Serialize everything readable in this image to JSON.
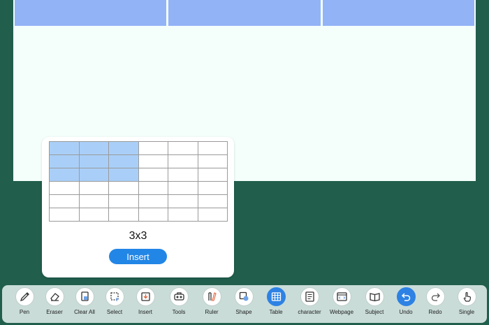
{
  "table_picker": {
    "rows": 6,
    "cols": 6,
    "selected_rows": 3,
    "selected_cols": 3,
    "size_label": "3x3",
    "insert_label": "Insert"
  },
  "toolbar": {
    "items": [
      {
        "label": "Pen",
        "icon": "pen-icon",
        "active": false
      },
      {
        "label": "Eraser",
        "icon": "eraser-icon",
        "active": false
      },
      {
        "label": "Clear All",
        "icon": "clear-all-icon",
        "active": false
      },
      {
        "label": "Select",
        "icon": "select-icon",
        "active": false
      },
      {
        "label": "Insert",
        "icon": "insert-icon",
        "active": false
      },
      {
        "label": "Tools",
        "icon": "tools-icon",
        "active": false
      },
      {
        "label": "Ruler",
        "icon": "ruler-icon",
        "active": false
      },
      {
        "label": "Shape",
        "icon": "shape-icon",
        "active": false
      },
      {
        "label": "Table",
        "icon": "table-icon",
        "active": true
      },
      {
        "label": "character",
        "icon": "character-icon",
        "active": false
      },
      {
        "label": "Webpage",
        "icon": "webpage-icon",
        "active": false
      },
      {
        "label": "Subject",
        "icon": "subject-icon",
        "active": false
      },
      {
        "label": "Undo",
        "icon": "undo-icon",
        "active": true
      },
      {
        "label": "Redo",
        "icon": "redo-icon",
        "active": false
      },
      {
        "label": "Single",
        "icon": "single-touch-icon",
        "active": false
      }
    ]
  },
  "colors": {
    "background": "#215e4c",
    "canvas": "#f4fffb",
    "table_header": "#93b3f7",
    "selection": "#a9cff8",
    "accent": "#2286e6"
  }
}
